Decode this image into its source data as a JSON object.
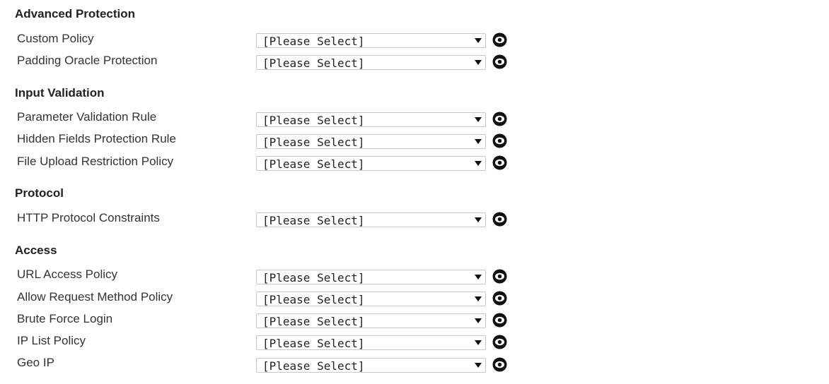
{
  "sections": [
    {
      "title": "Advanced Protection",
      "rows": [
        {
          "label": "Custom Policy",
          "value": "[Please Select]"
        },
        {
          "label": "Padding Oracle Protection",
          "value": "[Please Select]"
        }
      ]
    },
    {
      "title": "Input Validation",
      "rows": [
        {
          "label": "Parameter Validation Rule",
          "value": "[Please Select]"
        },
        {
          "label": "Hidden Fields Protection Rule",
          "value": "[Please Select]"
        },
        {
          "label": "File Upload Restriction Policy",
          "value": "[Please Select]"
        }
      ]
    },
    {
      "title": "Protocol",
      "rows": [
        {
          "label": "HTTP Protocol Constraints",
          "value": "[Please Select]"
        }
      ]
    },
    {
      "title": "Access",
      "rows": [
        {
          "label": "URL Access Policy",
          "value": "[Please Select]"
        },
        {
          "label": "Allow Request Method Policy",
          "value": "[Please Select]"
        },
        {
          "label": "Brute Force Login",
          "value": "[Please Select]"
        },
        {
          "label": "IP List Policy",
          "value": "[Please Select]"
        },
        {
          "label": "Geo IP",
          "value": "[Please Select]"
        }
      ]
    }
  ],
  "icons": {
    "view": "eye-icon",
    "dropdown": "chevron-down-icon"
  },
  "colors": {
    "text": "#222222",
    "select_border": "#c8c8c8",
    "icon": "#111111"
  }
}
